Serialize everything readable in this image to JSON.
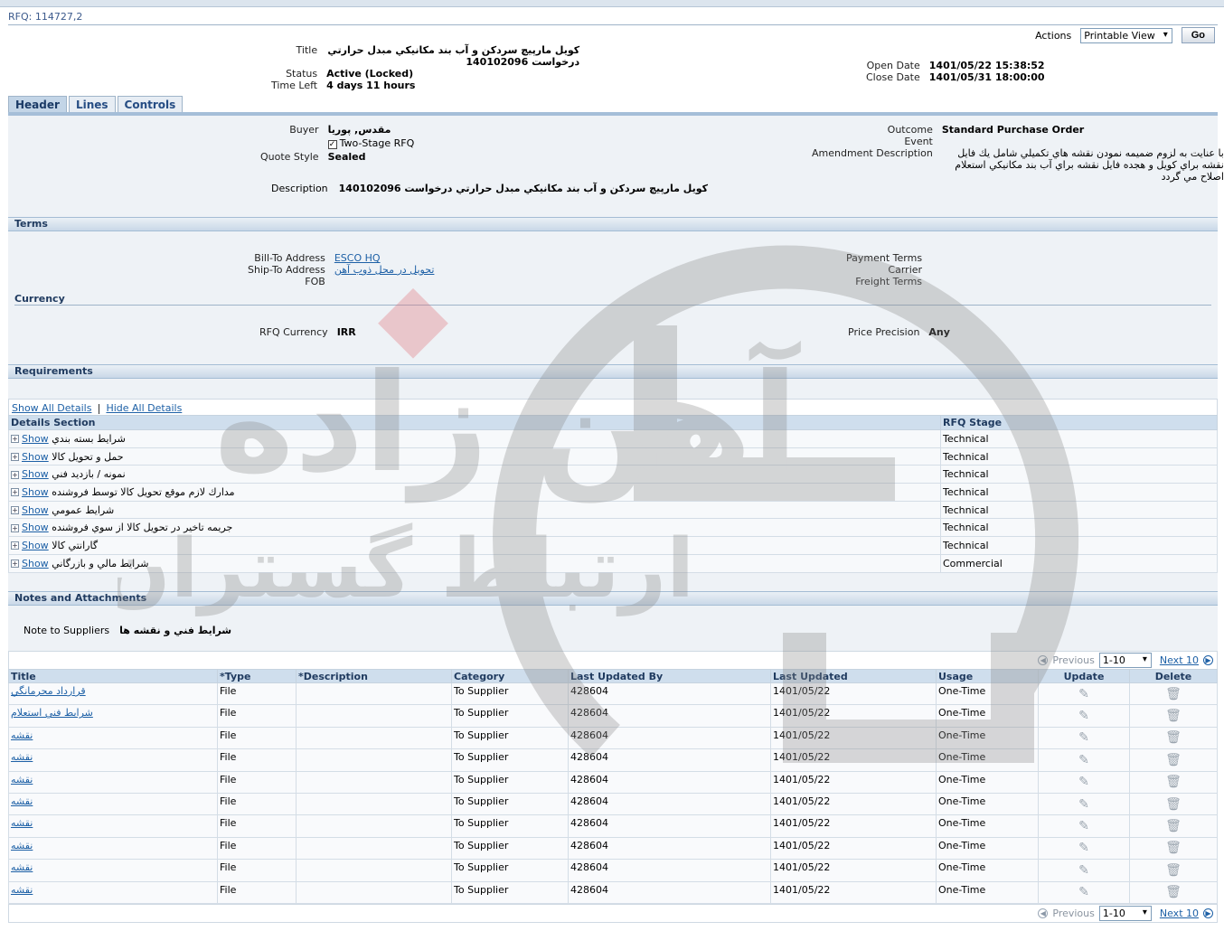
{
  "header": {
    "rfq_title": "RFQ: 114727,2",
    "actions_label": "Actions",
    "actions_selected": "Printable View",
    "go_label": "Go"
  },
  "summary": {
    "title_label": "Title",
    "title_value": "کويل مارپيچ سردکن و آب بند مکانيکي مبدل حرارتي درخواست 140102096",
    "status_label": "Status",
    "status_value": "Active (Locked)",
    "time_left_label": "Time Left",
    "time_left_value": "4 days 11 hours",
    "open_date_label": "Open Date",
    "open_date_value": "1401/05/22 15:38:52",
    "close_date_label": "Close Date",
    "close_date_value": "1401/05/31 18:00:00"
  },
  "tabs": [
    "Header",
    "Lines",
    "Controls"
  ],
  "header_section": {
    "buyer_label": "Buyer",
    "buyer_value": "مقدس, پوريا",
    "two_stage_label": "Two-Stage RFQ",
    "two_stage_checked": true,
    "quote_style_label": "Quote Style",
    "quote_style_value": "Sealed",
    "description_label": "Description",
    "description_value": "کويل مارپيچ سردکن و آب بند مکانيکي مبدل حرارتي درخواست 140102096",
    "outcome_label": "Outcome",
    "outcome_value": "Standard Purchase Order",
    "event_label": "Event",
    "amendment_label": "Amendment Description",
    "amendment_value": "با عنايت به لزوم ضميمه نمودن نقشه هاي تکميلي شامل يك فايل نقشه براي كويل و هجده فايل نقشه براي آب بند مكانيكي استعلام اصلاح مي گردد"
  },
  "terms": {
    "section_title": "Terms",
    "bill_to_label": "Bill-To Address",
    "bill_to_value": "ESCO HQ",
    "ship_to_label": "Ship-To Address",
    "ship_to_value": "تحویل در محل ذوب آهن",
    "fob_label": "FOB",
    "payment_terms_label": "Payment Terms",
    "carrier_label": "Carrier",
    "freight_terms_label": "Freight Terms",
    "currency_title": "Currency",
    "rfq_currency_label": "RFQ Currency",
    "rfq_currency_value": "IRR",
    "price_precision_label": "Price Precision",
    "price_precision_value": "Any"
  },
  "requirements": {
    "section_title": "Requirements",
    "show_all": "Show All Details",
    "hide_all": "Hide All Details",
    "col_details": "Details Section",
    "col_stage": "RFQ Stage",
    "show_label": "Show",
    "rows": [
      {
        "name": "شرايط بسته بندي",
        "stage": "Technical"
      },
      {
        "name": "حمل و تحويل كالا",
        "stage": "Technical"
      },
      {
        "name": "نمونه / بازديد فني",
        "stage": "Technical"
      },
      {
        "name": "مدارك لازم موقع تحويل كالا توسط فروشنده",
        "stage": "Technical"
      },
      {
        "name": "شرايط عمومي",
        "stage": "Technical"
      },
      {
        "name": "جريمه تاخير در تحويل كالا از سوي فروشنده",
        "stage": "Technical"
      },
      {
        "name": "گارانتي كالا",
        "stage": "Technical"
      },
      {
        "name": "شرايط مالي و بازرگاني",
        "stage": "Commercial"
      }
    ]
  },
  "notes": {
    "section_title": "Notes and Attachments",
    "note_label": "Note to Suppliers",
    "note_value": "شرايط فني و نقشه ها",
    "previous": "Previous",
    "range": "1-10",
    "next": "Next 10",
    "columns": {
      "title": "Title",
      "type": "*Type",
      "description": "*Description",
      "category": "Category",
      "last_updated_by": "Last Updated By",
      "last_updated": "Last Updated",
      "usage": "Usage",
      "update": "Update",
      "delete": "Delete"
    },
    "rows": [
      {
        "title": "قرارداد محرمانگي",
        "type": "File",
        "description": "",
        "category": "To Supplier",
        "by": "428604",
        "date": "1401/05/22",
        "usage": "One-Time"
      },
      {
        "title": "شرايط فني استعلام",
        "type": "File",
        "description": "",
        "category": "To Supplier",
        "by": "428604",
        "date": "1401/05/22",
        "usage": "One-Time"
      },
      {
        "title": "نقشه",
        "type": "File",
        "description": "",
        "category": "To Supplier",
        "by": "428604",
        "date": "1401/05/22",
        "usage": "One-Time"
      },
      {
        "title": "نقشه",
        "type": "File",
        "description": "",
        "category": "To Supplier",
        "by": "428604",
        "date": "1401/05/22",
        "usage": "One-Time"
      },
      {
        "title": "نقشه",
        "type": "File",
        "description": "",
        "category": "To Supplier",
        "by": "428604",
        "date": "1401/05/22",
        "usage": "One-Time"
      },
      {
        "title": "نقشه",
        "type": "File",
        "description": "",
        "category": "To Supplier",
        "by": "428604",
        "date": "1401/05/22",
        "usage": "One-Time"
      },
      {
        "title": "نقشه",
        "type": "File",
        "description": "",
        "category": "To Supplier",
        "by": "428604",
        "date": "1401/05/22",
        "usage": "One-Time"
      },
      {
        "title": "نقشه",
        "type": "File",
        "description": "",
        "category": "To Supplier",
        "by": "428604",
        "date": "1401/05/22",
        "usage": "One-Time"
      },
      {
        "title": "نقشه",
        "type": "File",
        "description": "",
        "category": "To Supplier",
        "by": "428604",
        "date": "1401/05/22",
        "usage": "One-Time"
      },
      {
        "title": "نقشه",
        "type": "File",
        "description": "",
        "category": "To Supplier",
        "by": "428604",
        "date": "1401/05/22",
        "usage": "One-Time"
      }
    ]
  },
  "watermark": {
    "text_main": "آهن زاده",
    "text_sub": "ارتباط گستران",
    "color": "#8a8a8a",
    "accent": "#e06b74"
  },
  "icons": {
    "update": "pencil-icon",
    "delete": "trash-icon",
    "previous": "chevron-left-icon",
    "next": "chevron-right-icon",
    "expand": "plus-icon"
  }
}
